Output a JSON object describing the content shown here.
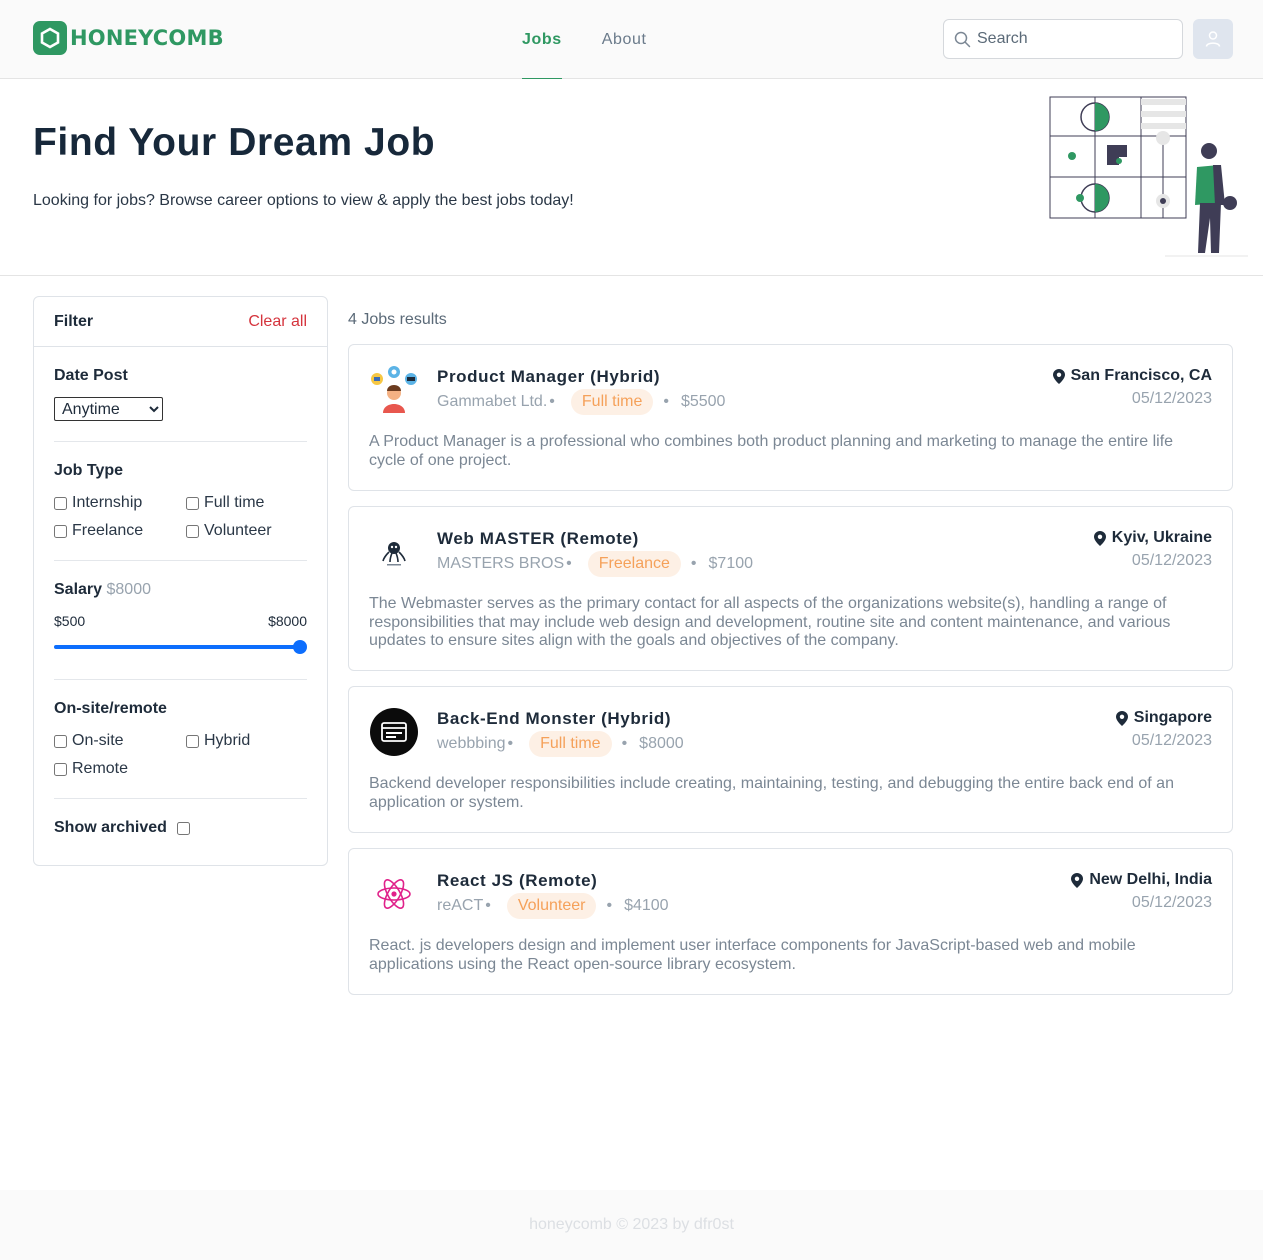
{
  "brand": {
    "name": "HONEYCOMB",
    "color": "#2f9862"
  },
  "nav": {
    "jobs": "Jobs",
    "about": "About"
  },
  "search": {
    "placeholder": "Search"
  },
  "hero": {
    "title": "Find Your Dream Job",
    "subtitle": "Looking for jobs? Browse career options to view & apply the best jobs today!"
  },
  "filter": {
    "title": "Filter",
    "clear_all": "Clear all",
    "date_post": {
      "label": "Date Post",
      "selected": "Anytime"
    },
    "job_type": {
      "label": "Job Type",
      "options": [
        "Internship",
        "Full time",
        "Freelance",
        "Volunteer"
      ]
    },
    "salary": {
      "label": "Salary",
      "value": "$8000",
      "min": "$500",
      "max": "$8000",
      "level": 1.0
    },
    "onsite_remote": {
      "label": "On-site/remote",
      "options": [
        "On-site",
        "Hybrid",
        "Remote"
      ]
    },
    "show_archived": "Show archived"
  },
  "results": {
    "count": "4 Jobs results",
    "jobs": [
      {
        "title": "Product Manager (Hybrid)",
        "company": "Gammabet Ltd.",
        "type": "Full time",
        "salary": "$5500",
        "location": "San Francisco, CA",
        "date": "05/12/2023",
        "description": "A Product Manager is a professional who combines both product planning and marketing to manage the entire life cycle of one project.",
        "logo": "product-manager-avatar-icon"
      },
      {
        "title": "Web MASTER (Remote)",
        "company": "MASTERS BROS",
        "type": "Freelance",
        "salary": "$7100",
        "location": "Kyiv, Ukraine",
        "date": "05/12/2023",
        "description": "The Webmaster serves as the primary contact for all aspects of the organizations website(s), handling a range of responsibilities that may include web design and development, routine site and content maintenance, and various updates to ensure sites align with the goals and objectives of the company.",
        "logo": "octopus-icon"
      },
      {
        "title": "Back-End Monster (Hybrid)",
        "company": "webbbing",
        "type": "Full time",
        "salary": "$8000",
        "location": "Singapore",
        "date": "05/12/2023",
        "description": "Backend developer responsibilities include creating, maintaining, testing, and debugging the entire back end of an application or system.",
        "logo": "browser-window-icon"
      },
      {
        "title": "React JS (Remote)",
        "company": "reACT",
        "type": "Volunteer",
        "salary": "$4100",
        "location": "New Delhi, India",
        "date": "05/12/2023",
        "description": "React. js developers design and implement user interface components for JavaScript-based web and mobile applications using the React open-source library ecosystem.",
        "logo": "react-atom-icon"
      }
    ]
  },
  "footer": "honeycomb © 2023 by dfr0st"
}
